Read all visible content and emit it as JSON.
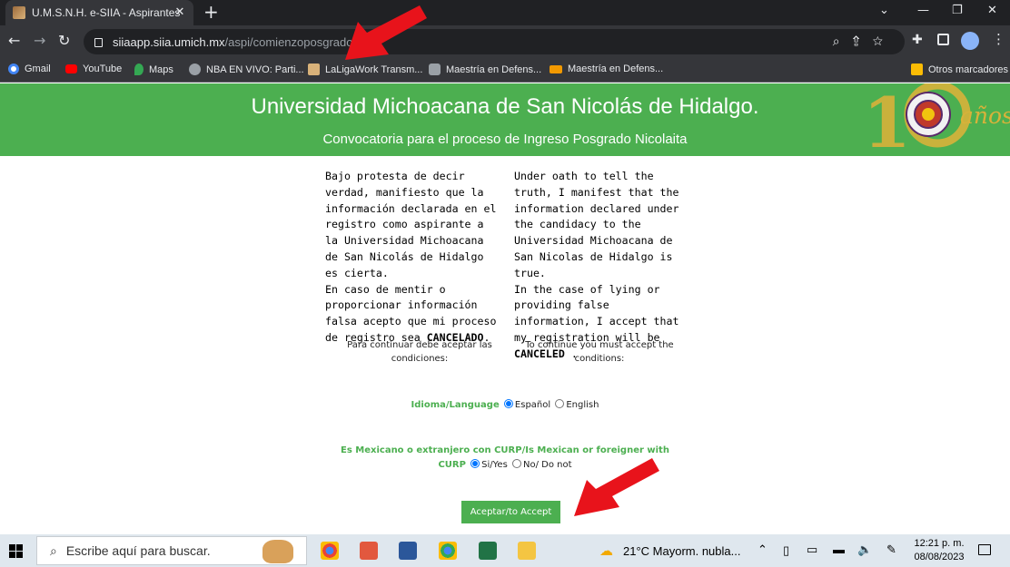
{
  "browser": {
    "tab_title": "U.M.S.N.H. e-SIIA - Aspirantes",
    "url_host": "siiaapp.siia.umich.mx",
    "url_path": "/aspi/comienzoposgrado",
    "bookmarks": [
      "Gmail",
      "YouTube",
      "Maps",
      "NBA EN VIVO: Parti...",
      "LaLigaWork Transm...",
      "Maestría en Defens...",
      "Maestría en Defens..."
    ],
    "other_bookmarks": "Otros marcadores"
  },
  "header": {
    "title": "Universidad Michoacana de San Nicolás de Hidalgo.",
    "subtitle": "Convocatoria para el proceso de Ingreso Posgrado Nicolaita",
    "logo_text": "años"
  },
  "declaration": {
    "es_text": "Bajo protesta de decir verdad, manifiesto que la información declarada en el registro como aspirante a la Universidad Michoacana de San Nicolás de Hidalgo es cierta.",
    "es_text2": "En caso de mentir o proporcionar información falsa acepto que mi proceso de registro sea ",
    "es_bold": "CANCELADO",
    "es_end": ".",
    "en_text": "Under oath to tell the truth, I manifest that the information declared under the candidacy to the Universidad Michoacana de San Nicolas de Hidalgo is true.",
    "en_text2": "In the case of lying or providing false information, I accept that my registration will be ",
    "en_bold": "CANCELED",
    "en_end": " .",
    "es_accept": "Para continuar debe aceptar las condiciones:",
    "en_accept": "To continue you must accept the conditions:"
  },
  "language": {
    "label": "Idioma/Language",
    "option1": "Español",
    "option2": "English",
    "selected": "Español"
  },
  "curp": {
    "label_line1": "Es Mexicano o extranjero con CURP/Is Mexican or foreigner with",
    "label_line2": "CURP",
    "option1": "Si/Yes",
    "option2": "No/ Do not",
    "selected": "Si/Yes"
  },
  "accept_button": "Aceptar/to Accept",
  "taskbar": {
    "search_placeholder": "Escribe aquí para buscar.",
    "weather": "21°C  Mayorm. nubla...",
    "time": "12:21 p. m.",
    "date": "08/08/2023"
  },
  "colors": {
    "accent_green": "#4caf50",
    "arrow_red": "#e8131b"
  }
}
